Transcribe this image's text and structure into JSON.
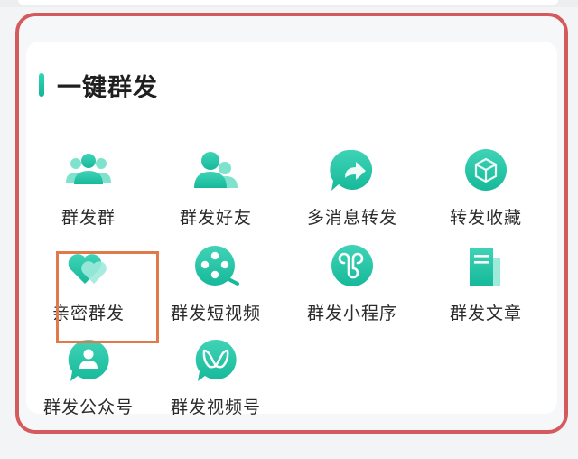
{
  "section": {
    "title": "一键群发"
  },
  "items": [
    {
      "label": "群发群",
      "icon": "group-chat-icon"
    },
    {
      "label": "群发好友",
      "icon": "friends-icon"
    },
    {
      "label": "多消息转发",
      "icon": "forward-icon"
    },
    {
      "label": "转发收藏",
      "icon": "favorites-box-icon"
    },
    {
      "label": "亲密群发",
      "icon": "heart-icon"
    },
    {
      "label": "群发短视频",
      "icon": "film-reel-icon"
    },
    {
      "label": "群发小程序",
      "icon": "mini-program-icon"
    },
    {
      "label": "群发文章",
      "icon": "article-icon"
    },
    {
      "label": "群发公众号",
      "icon": "official-account-icon"
    },
    {
      "label": "群发视频号",
      "icon": "video-channel-icon"
    }
  ],
  "colors": {
    "accent": "#16b99a",
    "accent_light": "#3fd3b6",
    "frame": "#d55a5e",
    "highlight": "#e07a4a"
  }
}
